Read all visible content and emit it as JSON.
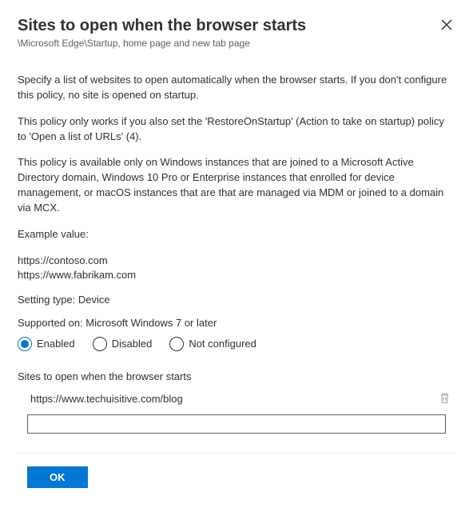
{
  "header": {
    "title": "Sites to open when the browser starts",
    "breadcrumb": "\\Microsoft Edge\\Startup, home page and new tab page"
  },
  "description": {
    "p1": "Specify a list of websites to open automatically when the browser starts. If you don't configure this policy, no site is opened on startup.",
    "p2": "This policy only works if you also set the 'RestoreOnStartup' (Action to take on startup) policy to 'Open a list of URLs' (4).",
    "p3": "This policy is available only on Windows instances that are joined to a Microsoft Active Directory domain, Windows 10 Pro or Enterprise instances that enrolled for device management, or macOS instances that are that are managed via MDM or joined to a domain via MCX.",
    "exampleLabel": "Example value:",
    "exampleUrl1": "https://contoso.com",
    "exampleUrl2": "https://www.fabrikam.com",
    "settingType": "Setting type: Device",
    "supported": "Supported on: Microsoft Windows 7 or later"
  },
  "radios": {
    "enabled": "Enabled",
    "disabled": "Disabled",
    "notConfigured": "Not configured"
  },
  "sitesSection": {
    "label": "Sites to open when the browser starts",
    "entry": "https://www.techuisitive.com/blog",
    "inputValue": ""
  },
  "buttons": {
    "ok": "OK"
  }
}
